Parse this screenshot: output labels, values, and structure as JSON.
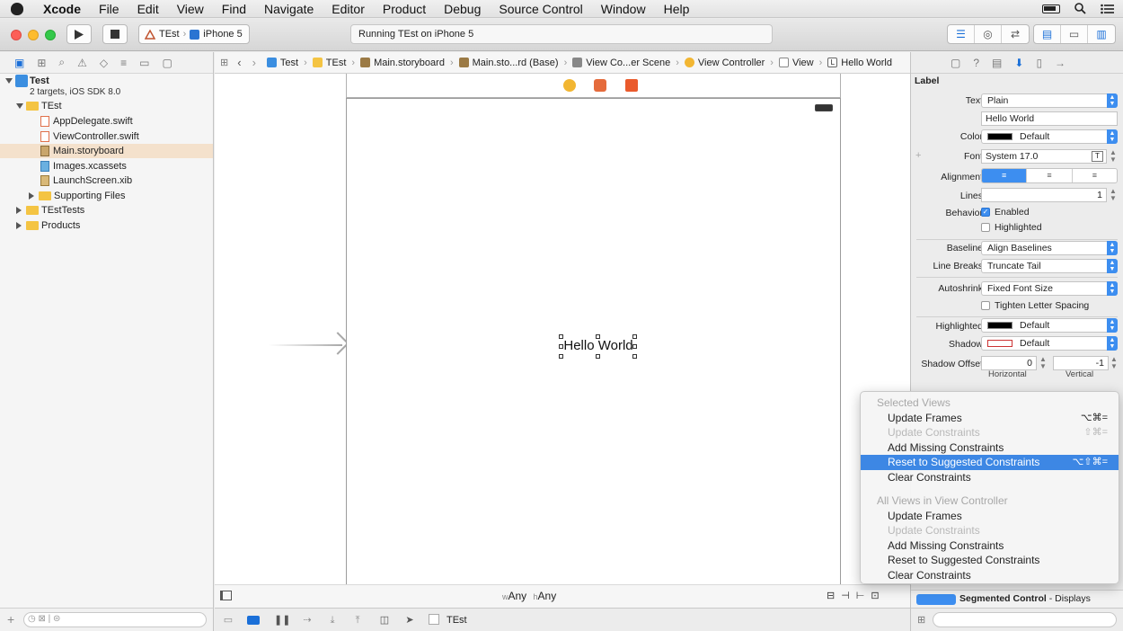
{
  "menubar": {
    "app": "Xcode",
    "items": [
      "File",
      "Edit",
      "View",
      "Find",
      "Navigate",
      "Editor",
      "Product",
      "Debug",
      "Source Control",
      "Window",
      "Help"
    ]
  },
  "toolbar": {
    "scheme": "TEst",
    "device": "iPhone 5",
    "status": "Running TEst on iPhone 5"
  },
  "navigator": {
    "project": {
      "name": "Test",
      "subtitle": "2 targets, iOS SDK 8.0"
    },
    "items": [
      {
        "label": "TEst"
      },
      {
        "label": "AppDelegate.swift"
      },
      {
        "label": "ViewController.swift"
      },
      {
        "label": "Main.storyboard"
      },
      {
        "label": "Images.xcassets"
      },
      {
        "label": "LaunchScreen.xib"
      },
      {
        "label": "Supporting Files"
      },
      {
        "label": "TEstTests"
      },
      {
        "label": "Products"
      }
    ]
  },
  "jumpbar": {
    "crumbs": [
      "Test",
      "TEst",
      "Main.storyboard",
      "Main.sto...rd (Base)",
      "View Co...er Scene",
      "View Controller",
      "View",
      "Hello World"
    ]
  },
  "canvas": {
    "label_text": "Hello World",
    "size_class_w": "w",
    "size_class_w_val": "Any",
    "size_class_h": "h",
    "size_class_h_val": "Any"
  },
  "editor_bottom": {
    "scheme": "TEst"
  },
  "inspector": {
    "section": "Label",
    "text_label": "Text",
    "text_type": "Plain",
    "text_value": "Hello World",
    "color_label": "Color",
    "color_value": "Default",
    "font_label": "Font",
    "font_value": "System 17.0",
    "alignment_label": "Alignment",
    "lines_label": "Lines",
    "lines_value": "1",
    "behavior_label": "Behavior",
    "enabled_label": "Enabled",
    "highlighted_label": "Highlighted",
    "baseline_label": "Baseline",
    "baseline_value": "Align Baselines",
    "linebreaks_label": "Line Breaks",
    "linebreaks_value": "Truncate Tail",
    "autoshrink_label": "Autoshrink",
    "autoshrink_value": "Fixed Font Size",
    "tighten_label": "Tighten Letter Spacing",
    "highlighted_color_label": "Highlighted",
    "highlighted_color_value": "Default",
    "shadow_label": "Shadow",
    "shadow_value": "Default",
    "shadow_offset_label": "Shadow Offset",
    "shadow_h": "0",
    "shadow_v": "-1",
    "horizontal_label": "Horizontal",
    "vertical_label": "Vertical",
    "library_item": "Segmented Control",
    "library_item_desc": " - Displays"
  },
  "resolve_menu": {
    "header1": "Selected Views",
    "items1": [
      {
        "label": "Update Frames",
        "shortcut": "⌥⌘=",
        "state": "normal"
      },
      {
        "label": "Update Constraints",
        "shortcut": "⇧⌘=",
        "state": "disabled"
      },
      {
        "label": "Add Missing Constraints",
        "shortcut": "",
        "state": "normal"
      },
      {
        "label": "Reset to Suggested Constraints",
        "shortcut": "⌥⇧⌘=",
        "state": "highlighted"
      },
      {
        "label": "Clear Constraints",
        "shortcut": "",
        "state": "normal"
      }
    ],
    "header2": "All Views in View Controller",
    "items2": [
      {
        "label": "Update Frames",
        "shortcut": "",
        "state": "normal"
      },
      {
        "label": "Update Constraints",
        "shortcut": "",
        "state": "disabled"
      },
      {
        "label": "Add Missing Constraints",
        "shortcut": "",
        "state": "normal"
      },
      {
        "label": "Reset to Suggested Constraints",
        "shortcut": "",
        "state": "normal"
      },
      {
        "label": "Clear Constraints",
        "shortcut": "",
        "state": "normal"
      }
    ]
  },
  "colors": {
    "accent": "#3d87e4",
    "selection": "#f4e1cc",
    "folder": "#f4c443"
  }
}
